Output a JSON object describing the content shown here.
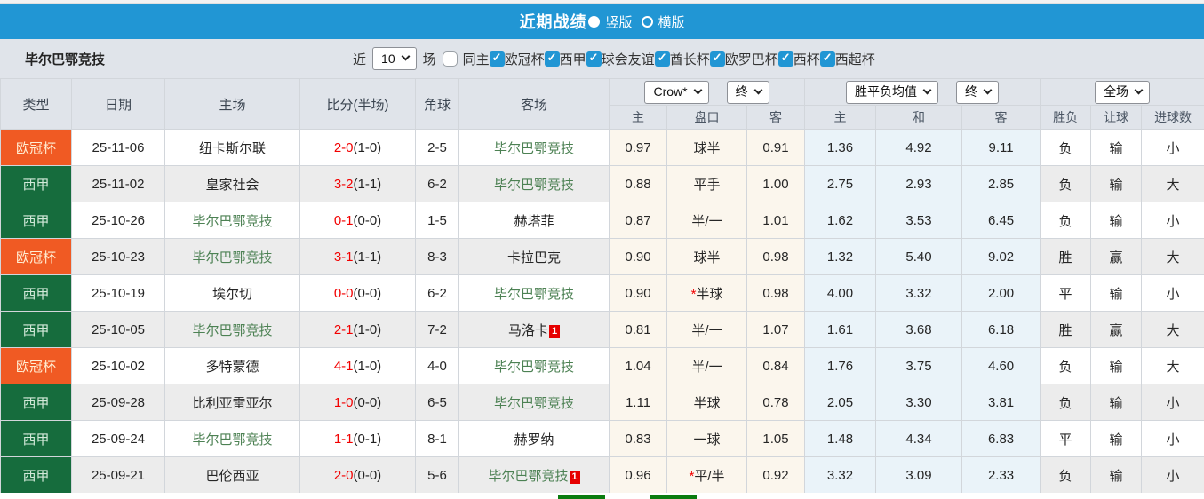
{
  "titlebar": {
    "title": "近期战绩",
    "options": [
      {
        "label": "竖版",
        "selected": true
      },
      {
        "label": "横版",
        "selected": false
      }
    ]
  },
  "filterbar": {
    "team": "毕尔巴鄂竞技",
    "recent_prefix": "近",
    "recent_value": "10",
    "recent_suffix": "场",
    "same_home": {
      "label": "同主",
      "checked": false
    },
    "competitions": [
      {
        "label": "欧冠杯",
        "checked": true
      },
      {
        "label": "西甲",
        "checked": true
      },
      {
        "label": "球会友谊",
        "checked": true
      },
      {
        "label": "酋长杯",
        "checked": true
      },
      {
        "label": "欧罗巴杯",
        "checked": true
      },
      {
        "label": "西杯",
        "checked": true
      },
      {
        "label": "西超杯",
        "checked": true
      }
    ]
  },
  "table": {
    "col_headers": {
      "type": "类型",
      "date": "日期",
      "home": "主场",
      "score": "比分(半场)",
      "corners": "角球",
      "away": "客场",
      "odds_home": "主",
      "odds_handicap": "盘口",
      "odds_away": "客",
      "avg_home": "主",
      "avg_draw": "和",
      "avg_away": "客",
      "result": "胜负",
      "handicap_result": "让球",
      "goals": "进球数"
    },
    "dropdowns": {
      "bookmaker": "Crow*",
      "bookmaker_stage": "终",
      "average": "胜平负均值",
      "average_stage": "终",
      "scope": "全场"
    },
    "rows": [
      {
        "type": "欧冠杯",
        "type_style": "ucl",
        "date": "25-11-06",
        "home": "纽卡斯尔联",
        "home_focus": false,
        "home_card": null,
        "score": "2-0",
        "half": "(1-0)",
        "corners": "2-5",
        "away": "毕尔巴鄂竞技",
        "away_focus": true,
        "away_card": null,
        "odds_home": "0.97",
        "handicap": "球半",
        "handicap_star": false,
        "odds_away": "0.91",
        "avg_home": "1.36",
        "avg_draw": "4.92",
        "avg_away": "9.11",
        "result": "负",
        "result_color": "green",
        "handicap_result": "输",
        "handicap_result_color": "green",
        "goals": "小",
        "goals_color": "green"
      },
      {
        "type": "西甲",
        "type_style": "liga",
        "date": "25-11-02",
        "home": "皇家社会",
        "home_focus": false,
        "home_card": null,
        "score": "3-2",
        "half": "(1-1)",
        "corners": "6-2",
        "away": "毕尔巴鄂竞技",
        "away_focus": true,
        "away_card": null,
        "odds_home": "0.88",
        "handicap": "平手",
        "handicap_star": false,
        "odds_away": "1.00",
        "avg_home": "2.75",
        "avg_draw": "2.93",
        "avg_away": "2.85",
        "result": "负",
        "result_color": "green",
        "handicap_result": "输",
        "handicap_result_color": "green",
        "goals": "大",
        "goals_color": "red"
      },
      {
        "type": "西甲",
        "type_style": "liga",
        "date": "25-10-26",
        "home": "毕尔巴鄂竞技",
        "home_focus": true,
        "home_card": null,
        "score": "0-1",
        "half": "(0-0)",
        "corners": "1-5",
        "away": "赫塔菲",
        "away_focus": false,
        "away_card": null,
        "odds_home": "0.87",
        "handicap": "半/一",
        "handicap_star": false,
        "odds_away": "1.01",
        "avg_home": "1.62",
        "avg_draw": "3.53",
        "avg_away": "6.45",
        "result": "负",
        "result_color": "green",
        "handicap_result": "输",
        "handicap_result_color": "green",
        "goals": "小",
        "goals_color": "green"
      },
      {
        "type": "欧冠杯",
        "type_style": "ucl",
        "date": "25-10-23",
        "home": "毕尔巴鄂竞技",
        "home_focus": true,
        "home_card": null,
        "score": "3-1",
        "half": "(1-1)",
        "corners": "8-3",
        "away": "卡拉巴克",
        "away_focus": false,
        "away_card": null,
        "odds_home": "0.90",
        "handicap": "球半",
        "handicap_star": false,
        "odds_away": "0.98",
        "avg_home": "1.32",
        "avg_draw": "5.40",
        "avg_away": "9.02",
        "result": "胜",
        "result_color": "red",
        "handicap_result": "赢",
        "handicap_result_color": "red",
        "goals": "大",
        "goals_color": "red"
      },
      {
        "type": "西甲",
        "type_style": "liga",
        "date": "25-10-19",
        "home": "埃尔切",
        "home_focus": false,
        "home_card": null,
        "score": "0-0",
        "half": "(0-0)",
        "corners": "6-2",
        "away": "毕尔巴鄂竞技",
        "away_focus": true,
        "away_card": null,
        "odds_home": "0.90",
        "handicap": "半球",
        "handicap_star": true,
        "odds_away": "0.98",
        "avg_home": "4.00",
        "avg_draw": "3.32",
        "avg_away": "2.00",
        "result": "平",
        "result_color": "blue",
        "handicap_result": "输",
        "handicap_result_color": "green",
        "goals": "小",
        "goals_color": "green"
      },
      {
        "type": "西甲",
        "type_style": "liga",
        "date": "25-10-05",
        "home": "毕尔巴鄂竞技",
        "home_focus": true,
        "home_card": null,
        "score": "2-1",
        "half": "(1-0)",
        "corners": "7-2",
        "away": "马洛卡",
        "away_focus": false,
        "away_card": "1",
        "odds_home": "0.81",
        "handicap": "半/一",
        "handicap_star": false,
        "odds_away": "1.07",
        "avg_home": "1.61",
        "avg_draw": "3.68",
        "avg_away": "6.18",
        "result": "胜",
        "result_color": "red",
        "handicap_result": "赢",
        "handicap_result_color": "red",
        "goals": "大",
        "goals_color": "red"
      },
      {
        "type": "欧冠杯",
        "type_style": "ucl",
        "date": "25-10-02",
        "home": "多特蒙德",
        "home_focus": false,
        "home_card": null,
        "score": "4-1",
        "half": "(1-0)",
        "corners": "4-0",
        "away": "毕尔巴鄂竞技",
        "away_focus": true,
        "away_card": null,
        "odds_home": "1.04",
        "handicap": "半/一",
        "handicap_star": false,
        "odds_away": "0.84",
        "avg_home": "1.76",
        "avg_draw": "3.75",
        "avg_away": "4.60",
        "result": "负",
        "result_color": "green",
        "handicap_result": "输",
        "handicap_result_color": "green",
        "goals": "大",
        "goals_color": "red"
      },
      {
        "type": "西甲",
        "type_style": "liga",
        "date": "25-09-28",
        "home": "比利亚雷亚尔",
        "home_focus": false,
        "home_card": null,
        "score": "1-0",
        "half": "(0-0)",
        "corners": "6-5",
        "away": "毕尔巴鄂竞技",
        "away_focus": true,
        "away_card": null,
        "odds_home": "1.11",
        "handicap": "半球",
        "handicap_star": false,
        "odds_away": "0.78",
        "avg_home": "2.05",
        "avg_draw": "3.30",
        "avg_away": "3.81",
        "result": "负",
        "result_color": "green",
        "handicap_result": "输",
        "handicap_result_color": "green",
        "goals": "小",
        "goals_color": "green"
      },
      {
        "type": "西甲",
        "type_style": "liga",
        "date": "25-09-24",
        "home": "毕尔巴鄂竞技",
        "home_focus": true,
        "home_card": null,
        "score": "1-1",
        "half": "(0-1)",
        "corners": "8-1",
        "away": "赫罗纳",
        "away_focus": false,
        "away_card": null,
        "odds_home": "0.83",
        "handicap": "一球",
        "handicap_star": false,
        "odds_away": "1.05",
        "avg_home": "1.48",
        "avg_draw": "4.34",
        "avg_away": "6.83",
        "result": "平",
        "result_color": "blue",
        "handicap_result": "输",
        "handicap_result_color": "green",
        "goals": "小",
        "goals_color": "green"
      },
      {
        "type": "西甲",
        "type_style": "liga",
        "date": "25-09-21",
        "home": "巴伦西亚",
        "home_focus": false,
        "home_card": null,
        "score": "2-0",
        "half": "(0-0)",
        "corners": "5-6",
        "away": "毕尔巴鄂竞技",
        "away_focus": true,
        "away_card": "1",
        "odds_home": "0.96",
        "handicap": "平/半",
        "handicap_star": true,
        "odds_away": "0.92",
        "avg_home": "3.32",
        "avg_draw": "3.09",
        "avg_away": "2.33",
        "result": "负",
        "result_color": "green",
        "handicap_result": "输",
        "handicap_result_color": "green",
        "goals": "小",
        "goals_color": "green"
      }
    ]
  },
  "colors": {
    "header_blue": "#2196d4",
    "ucl_orange": "#f05a23",
    "laliga_green": "#166c3d",
    "focus_team_green": "#4c8153",
    "score_red": "#f20000",
    "win_red": "#ee4545",
    "lose_green": "#4e7c52",
    "draw_blue": "#4c6cea",
    "odds_bg_cream": "#fbf6ed",
    "avg_bg_blue": "#eaf3f9",
    "legend_green": "#0a7c10"
  }
}
